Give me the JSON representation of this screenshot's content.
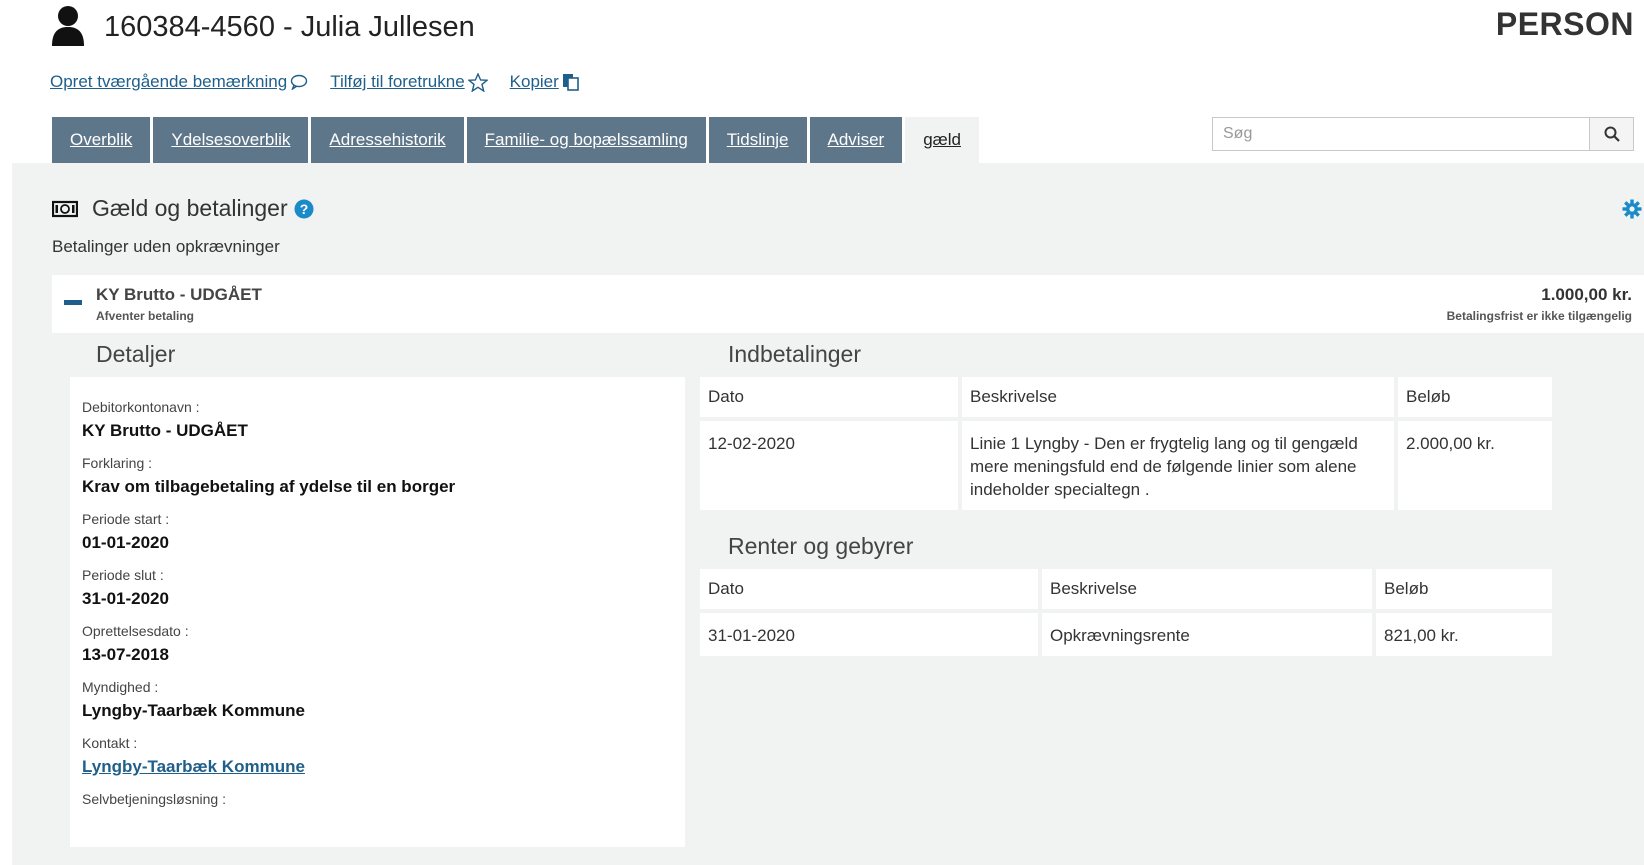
{
  "header": {
    "title": "160384-4560 - Julia Jullesen",
    "type_label": "PERSON"
  },
  "actions": [
    {
      "label": "Opret tværgående bemærkning",
      "icon": "comment-icon"
    },
    {
      "label": "Tilføj til foretrukne",
      "icon": "star-icon"
    },
    {
      "label": "Kopier",
      "icon": "copy-icon"
    }
  ],
  "tabs": [
    {
      "label": "Overblik"
    },
    {
      "label": "Ydelsesoverblik"
    },
    {
      "label": "Adressehistorik"
    },
    {
      "label": "Familie- og bopælssamling"
    },
    {
      "label": "Tidslinje"
    },
    {
      "label": "Adviser"
    },
    {
      "label": "gæld",
      "active": true
    }
  ],
  "search": {
    "placeholder": "Søg",
    "value": ""
  },
  "section": {
    "title": "Gæld og betalinger",
    "subtitle": "Betalinger uden opkrævninger"
  },
  "debt": {
    "name": "KY Brutto - UDGÅET",
    "status": "Afventer betaling",
    "amount": "1.000,00 kr.",
    "deadline": "Betalingsfrist er ikke tilgængelig"
  },
  "details": {
    "title": "Detaljer",
    "fields": [
      {
        "label": "Debitorkontonavn :",
        "value": "KY Brutto - UDGÅET"
      },
      {
        "label": "Forklaring :",
        "value": "Krav om tilbagebetaling af ydelse til en borger"
      },
      {
        "label": "Periode start :",
        "value": "01-01-2020"
      },
      {
        "label": "Periode slut :",
        "value": "31-01-2020"
      },
      {
        "label": "Oprettelsesdato :",
        "value": "13-07-2018"
      },
      {
        "label": "Myndighed :",
        "value": "Lyngby-Taarbæk Kommune"
      },
      {
        "label": "Kontakt :",
        "value": "Lyngby-Taarbæk Kommune"
      },
      {
        "label": "Selvbetjeningsløsning :",
        "value": ""
      }
    ]
  },
  "payments": {
    "title": "Indbetalinger",
    "columns": [
      "Dato",
      "Beskrivelse",
      "Beløb"
    ],
    "rows": [
      [
        "12-02-2020",
        "Linie 1 Lyngby - Den er frygtelig lang og til gengæld mere meningsfuld end de følgende linier som alene indeholder specialtegn .",
        "2.000,00 kr."
      ]
    ]
  },
  "fees": {
    "title": "Renter og gebyrer",
    "columns": [
      "Dato",
      "Beskrivelse",
      "Beløb"
    ],
    "rows": [
      [
        "31-01-2020",
        "Opkrævningsrente",
        "821,00 kr."
      ]
    ]
  },
  "colors": {
    "tab_bg": "#5e7689",
    "link": "#1f5f8b",
    "panel_bg": "#f1f2f2",
    "accent_icon": "#1a8ac9"
  }
}
